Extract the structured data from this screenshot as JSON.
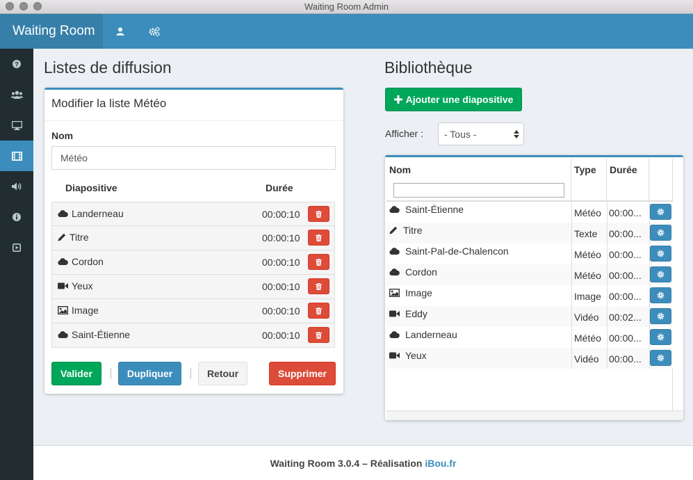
{
  "window": {
    "title": "Waiting Room Admin"
  },
  "navbar": {
    "brand": "Waiting Room"
  },
  "left": {
    "heading": "Listes de diffusion",
    "box_title": "Modifier la liste Météo",
    "name_label": "Nom",
    "name_value": "Météo",
    "col_slide": "Diapositive",
    "col_duration": "Durée",
    "slides": [
      {
        "icon": "cloud-icon",
        "name": "Landerneau",
        "duration": "00:00:10"
      },
      {
        "icon": "pencil-icon",
        "name": "Titre",
        "duration": "00:00:10"
      },
      {
        "icon": "cloud-icon",
        "name": "Cordon",
        "duration": "00:00:10"
      },
      {
        "icon": "video-icon",
        "name": "Yeux",
        "duration": "00:00:10"
      },
      {
        "icon": "image-icon",
        "name": "Image",
        "duration": "00:00:10"
      },
      {
        "icon": "cloud-icon",
        "name": "Saint-Étienne",
        "duration": "00:00:10"
      }
    ],
    "buttons": {
      "validate": "Valider",
      "duplicate": "Dupliquer",
      "back": "Retour",
      "delete": "Supprimer"
    }
  },
  "right": {
    "heading": "Bibliothèque",
    "add_button": "Ajouter une diapositive",
    "filter_label": "Afficher :",
    "filter_value": "- Tous -",
    "columns": {
      "name": "Nom",
      "type": "Type",
      "duration": "Durée"
    },
    "rows": [
      {
        "icon": "cloud-icon",
        "name": "Saint-Étienne",
        "type": "Météo",
        "duration": "00:00..."
      },
      {
        "icon": "pencil-icon",
        "name": "Titre",
        "type": "Texte",
        "duration": "00:00..."
      },
      {
        "icon": "cloud-icon",
        "name": "Saint-Pal-de-Chalencon",
        "type": "Météo",
        "duration": "00:00..."
      },
      {
        "icon": "cloud-icon",
        "name": "Cordon",
        "type": "Météo",
        "duration": "00:00..."
      },
      {
        "icon": "image-icon",
        "name": "Image",
        "type": "Image",
        "duration": "00:00..."
      },
      {
        "icon": "video-icon",
        "name": "Eddy",
        "type": "Vidéo",
        "duration": "00:02..."
      },
      {
        "icon": "cloud-icon",
        "name": "Landerneau",
        "type": "Météo",
        "duration": "00:00..."
      },
      {
        "icon": "video-icon",
        "name": "Yeux",
        "type": "Vidéo",
        "duration": "00:00..."
      }
    ]
  },
  "footer": {
    "text": "Waiting Room 3.0.4 – Réalisation ",
    "link": "iBou.fr"
  },
  "colors": {
    "primary": "#3c8dbc",
    "success": "#00a65a",
    "danger": "#dd4b39",
    "sidebar": "#222d32"
  }
}
